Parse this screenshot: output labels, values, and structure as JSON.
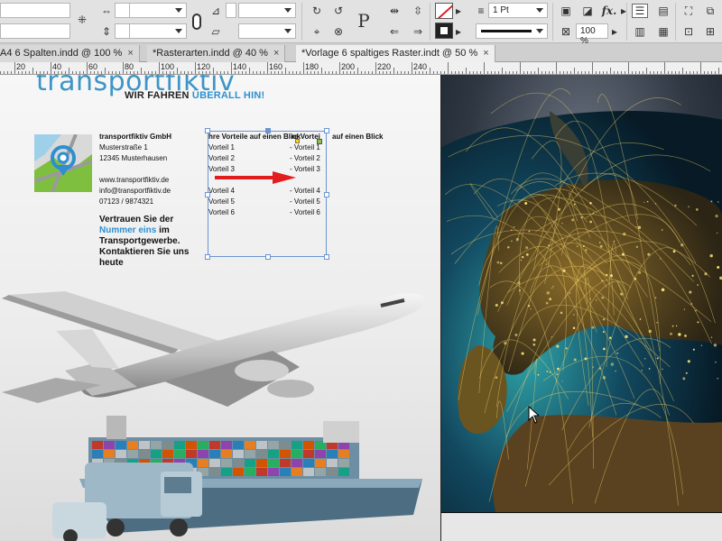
{
  "control_bar": {
    "stroke_weight": "1 Pt",
    "zoom": "100 %",
    "fx_label": "fx."
  },
  "tabs": [
    {
      "label": "A4 6 Spalten.indd @ 100 %",
      "active": false
    },
    {
      "label": "*Rasterarten.indd @ 40 %",
      "active": false
    },
    {
      "label": "*Vorlage 6 spaltiges Raster.indt @ 50 %",
      "active": true
    }
  ],
  "tab_close": "×",
  "ruler": {
    "labels": [
      "20",
      "40",
      "60",
      "80",
      "100",
      "120",
      "140",
      "160",
      "180",
      "200",
      "220",
      "240"
    ]
  },
  "page": {
    "brand": "transportfiktiv",
    "tagline_prefix": "WIR FAHREN ",
    "tagline_highlight": "ÜBERALL HIN!",
    "company": "transportfiktiv GmbH",
    "street": "Musterstraße 1",
    "city": "12345 Musterhausen",
    "website": "www.transportfiktiv.de",
    "email": "info@transportfiktiv.de",
    "phone": "07123 / 9874321",
    "trust_1": "Vertrauen Sie der ",
    "trust_highlight": "Nummer eins",
    "trust_2": " im Transportgewerbe. Kontaktieren Sie uns heute",
    "table_heading_left": "hre Vorteile auf einen Blick",
    "table_heading_mid": "re Vortei",
    "table_heading_right": "auf einen Blick",
    "left_col": [
      "Vorteil 1",
      "Vorteil 2",
      "Vorteil 3",
      "",
      "Vorteil 4",
      "Vorteil 5",
      "Vorteil 6"
    ],
    "right_col": [
      "- Vorteil 1",
      "- Vorteil 2",
      "- Vorteil 3",
      "",
      "- Vorteil 4",
      "- Vorteil 5",
      "- Vorteil 6"
    ]
  },
  "colors": {
    "brand_blue": "#3d95c7",
    "frame_blue": "#6b94d0",
    "arrow_red": "#e21d1d",
    "ui_gray": "#e2e2e2"
  }
}
